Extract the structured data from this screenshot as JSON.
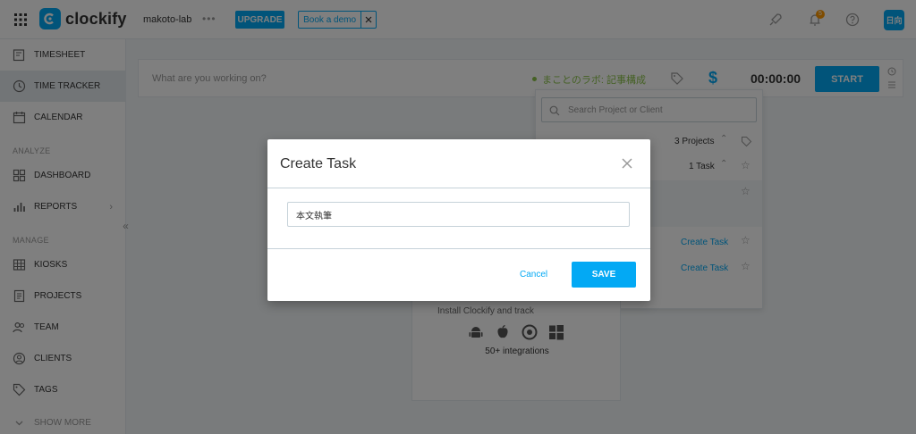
{
  "app": {
    "name": "clockify",
    "workspace": "makoto-lab",
    "upgrade_label": "UPGRADE",
    "demo_label": "Book a demo",
    "notification_count": "5",
    "avatar_initials": "日向"
  },
  "sidebar": {
    "items": [
      {
        "label": "TIMESHEET",
        "icon": "timesheet-icon"
      },
      {
        "label": "TIME TRACKER",
        "icon": "clock-icon",
        "active": true
      },
      {
        "label": "CALENDAR",
        "icon": "calendar-icon"
      },
      {
        "label": "DASHBOARD",
        "icon": "dashboard-icon"
      },
      {
        "label": "REPORTS",
        "icon": "reports-icon"
      },
      {
        "label": "KIOSKS",
        "icon": "kiosk-icon"
      },
      {
        "label": "PROJECTS",
        "icon": "projects-icon"
      },
      {
        "label": "TEAM",
        "icon": "team-icon"
      },
      {
        "label": "CLIENTS",
        "icon": "clients-icon"
      },
      {
        "label": "TAGS",
        "icon": "tag-icon"
      },
      {
        "label": "SHOW MORE",
        "icon": "chevron-down-icon"
      }
    ],
    "sections": {
      "analyze": "ANALYZE",
      "manage": "MANAGE"
    }
  },
  "timer": {
    "placeholder": "What are you working on?",
    "project": "まことのラボ: 記事構成",
    "project_color": "#8bc34a",
    "time": "00:00:00",
    "start_label": "START",
    "currency_symbol": "$"
  },
  "project_dropdown": {
    "search_placeholder": "Search Project or Client",
    "projects_count": "3 Projects",
    "tasks_count": "1 Task",
    "create_task_1": "Create Task",
    "create_task_2": "Create Task"
  },
  "integrations": {
    "text": "Install Clockify and track",
    "footer": "50+ integrations"
  },
  "modal": {
    "title": "Create Task",
    "input_value": "本文執筆",
    "cancel_label": "Cancel",
    "save_label": "SAVE"
  },
  "colors": {
    "accent": "#03a9f4",
    "overlay": "rgba(0,0,0,0.5)",
    "badge": "#ff9800"
  }
}
